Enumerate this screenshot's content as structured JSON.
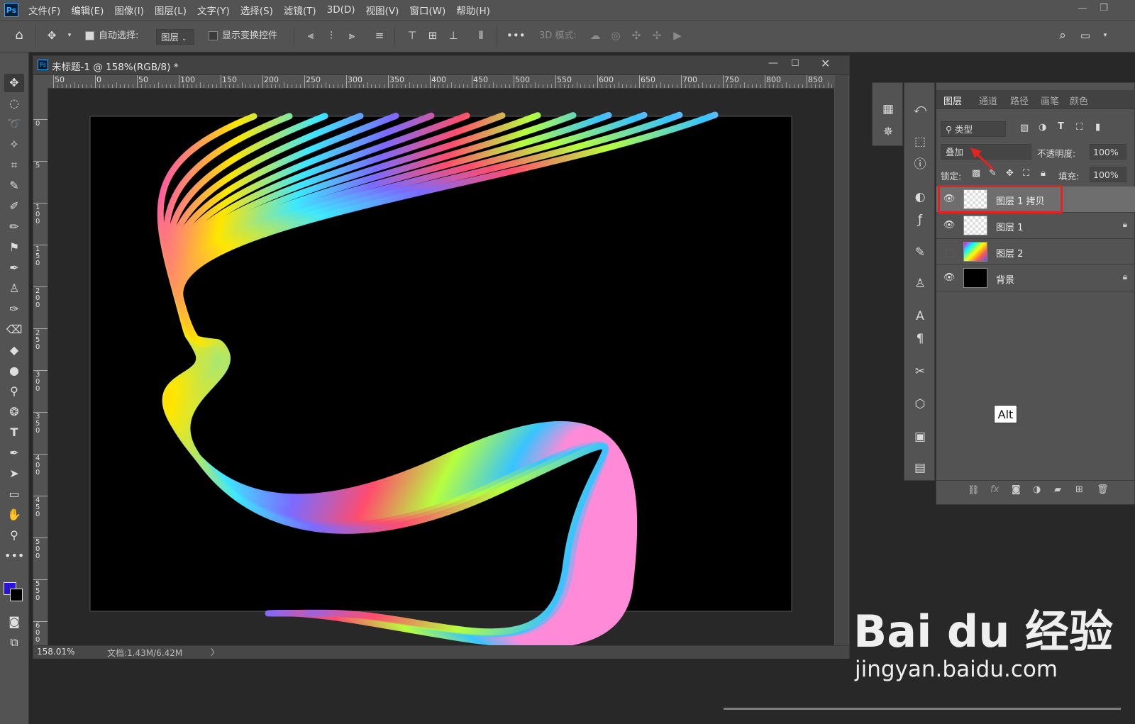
{
  "app": {
    "logo_text": "Ps"
  },
  "menu": [
    "文件(F)",
    "编辑(E)",
    "图像(I)",
    "图层(L)",
    "文字(Y)",
    "选择(S)",
    "滤镜(T)",
    "3D(D)",
    "视图(V)",
    "窗口(W)",
    "帮助(H)"
  ],
  "options": {
    "auto_select_label": "自动选择:",
    "auto_select_checked": true,
    "target_value": "图层",
    "show_transform_label": "显示变换控件",
    "mode3d_label": "3D 模式:"
  },
  "document": {
    "tab_title": "未标题-1 @ 158%(RGB/8) *",
    "zoom": "158.01%",
    "doc_size": "文档:1.43M/6.42M",
    "ruler_top": [
      "50",
      "0",
      "50",
      "100",
      "150",
      "200",
      "250",
      "300",
      "350",
      "400",
      "450",
      "500",
      "550",
      "600",
      "650",
      "700",
      "750",
      "800",
      "850"
    ],
    "ruler_left": [
      "0",
      "5",
      "1 0 0",
      "1 5 0",
      "2 0 0",
      "2 5 0",
      "3 0 0",
      "3 5 0",
      "4 0 0",
      "4 5 0",
      "5 0 0",
      "5 5 0",
      "6 0 0"
    ]
  },
  "layers_panel": {
    "tabs": [
      "图层",
      "通道",
      "路径",
      "画笔",
      "颜色"
    ],
    "active_tab": 0,
    "filter_label": "类型",
    "blend_mode": "叠加",
    "opacity_label": "不透明度:",
    "opacity_value": "100%",
    "lock_label": "锁定:",
    "fill_label": "填充:",
    "fill_value": "100%",
    "layers": [
      {
        "name": "图层 1 拷贝",
        "visible": true,
        "locked": false,
        "thumb": "checker",
        "selected": true
      },
      {
        "name": "图层 1",
        "visible": true,
        "locked": true,
        "thumb": "checker",
        "selected": false
      },
      {
        "name": "图层 2",
        "visible": false,
        "locked": false,
        "thumb": "rainbow",
        "selected": false
      },
      {
        "name": "背景",
        "visible": true,
        "locked": true,
        "thumb": "black",
        "selected": false
      }
    ]
  },
  "tooltip": {
    "text": "Alt"
  },
  "watermark": {
    "logo": "Bai du 经验",
    "url": "jingyan.baidu.com"
  },
  "colors": {
    "foreground": "#2a14d4",
    "background": "#000000",
    "highlight": "#e6221f"
  }
}
